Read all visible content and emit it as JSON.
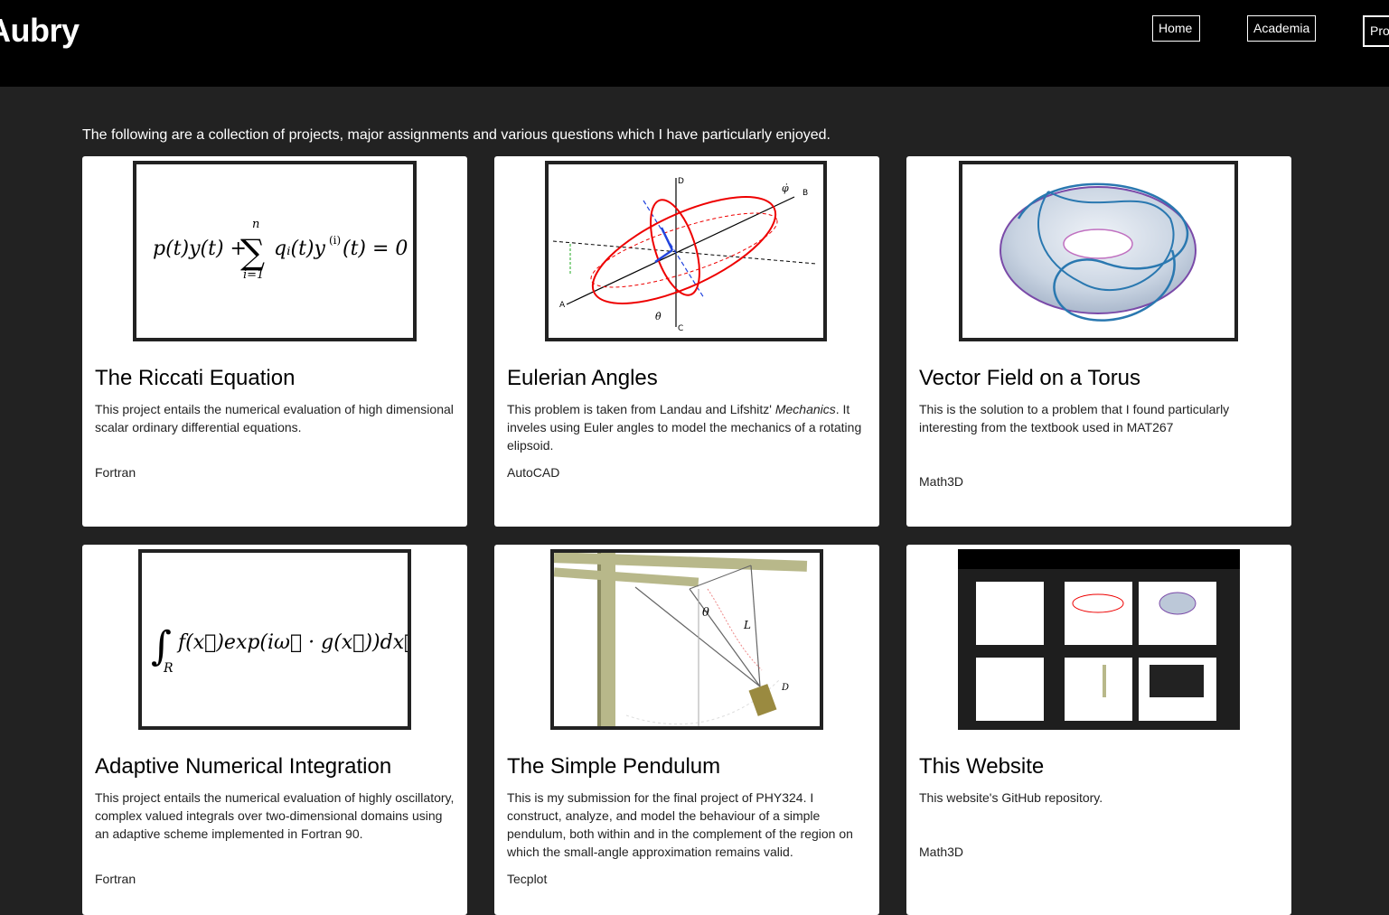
{
  "header": {
    "site_title": "Aubry",
    "nav": [
      "Home",
      "Academia",
      "Projects"
    ]
  },
  "intro_text": "The following are a collection of projects, major assignments and various questions which I have particularly enjoyed.",
  "cards": [
    {
      "title": "The Riccati Equation",
      "desc": "This project entails the numerical evaluation of high dimensional scalar ordinary differential equations.",
      "tag": "Fortran",
      "thumb_formula": "p(t)y(t) + ∑ qᵢ(t)y⁽ⁱ⁾(t) = 0"
    },
    {
      "title": "Eulerian Angles",
      "desc_before": "This problem is taken from Landau and Lifshitz' ",
      "desc_italic": "Mechanics",
      "desc_after": ". It inveles using Euler angles to model the mechanics of a rotating elipsoid.",
      "tag": "AutoCAD",
      "diagram_labels": [
        "D",
        "B",
        "A",
        "C",
        "φ̇",
        "θ̇"
      ]
    },
    {
      "title": "Vector Field on a Torus",
      "desc": "This is the solution to a problem that I found particularly interesting from the textbook used in MAT267",
      "tag": "Math3D"
    },
    {
      "title": "Adaptive Numerical Integration",
      "desc": "This project entails the numerical evaluation of highly oscillatory, complex valued integrals over two-dimensional domains using an adaptive scheme implemented in Fortran 90.",
      "tag": "Fortran",
      "thumb_formula": "f(x⃗)exp(iω⃗ · g(x⃗))dx⃗"
    },
    {
      "title": "The Simple Pendulum",
      "desc": "This is my submission for the final project of PHY324. I construct, analyze, and model the behaviour of a simple pendulum, both within and in the complement of the region on which the small-angle approximation remains valid.",
      "tag": "Tecplot",
      "diagram_labels": [
        "θ",
        "L",
        "D"
      ]
    },
    {
      "title": "This Website",
      "desc": "This website's GitHub repository.",
      "tag": "Math3D"
    }
  ]
}
